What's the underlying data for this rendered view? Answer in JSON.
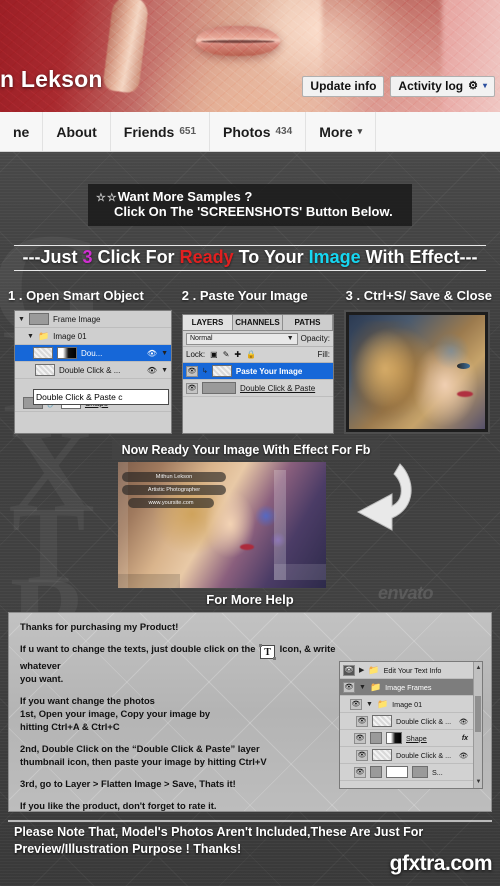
{
  "cover": {
    "profile_name": "n Lekson",
    "buttons": [
      {
        "label": "Update info",
        "icon": ""
      },
      {
        "label": "Activity log",
        "icon": "gear-icon",
        "caret": "▾"
      }
    ]
  },
  "nav": {
    "items": [
      {
        "label": "ne",
        "count": ""
      },
      {
        "label": "About",
        "count": ""
      },
      {
        "label": "Friends",
        "count": "651"
      },
      {
        "label": "Photos",
        "count": "434"
      },
      {
        "label": "More",
        "count": "",
        "caret": "▾"
      }
    ]
  },
  "samples": {
    "stars": "☆☆",
    "line1": "Want More Samples ?",
    "line2": "Click On The 'SCREENSHOTS' Button Below."
  },
  "headline": {
    "p1": "---Just ",
    "num": "3",
    "p2": " Click For ",
    "red": "Ready",
    "p3": " To Your ",
    "cyan": "Image",
    "p4": " With Effect---"
  },
  "steps": [
    "1 . Open Smart Object",
    "2 . Paste Your Image",
    "3 . Ctrl+S/ Save & Close"
  ],
  "panel_a": {
    "rows": [
      {
        "label": "Frame Image",
        "type": "group"
      },
      {
        "label": "Image 01",
        "type": "group"
      },
      {
        "label": "Dou...",
        "type": "layer-selected"
      },
      {
        "label": "Double Click & ...",
        "type": "layer"
      },
      {
        "label": "Shape",
        "type": "layer"
      }
    ],
    "callout": "Double Click & Paste c"
  },
  "panel_b": {
    "tabs": [
      "LAYERS",
      "CHANNELS",
      "PATHS"
    ],
    "blend_mode": "Normal",
    "opacity_label": "Opacity:",
    "lock_label": "Lock:",
    "fill_label": "Fill:",
    "rows": [
      {
        "label": "Paste Your Image",
        "type": "layer-selected"
      },
      {
        "label": "Double Click & Paste",
        "type": "layer"
      }
    ]
  },
  "result": {
    "title": "Now Ready Your Image With Effect For Fb",
    "overlay": [
      "Mithun Lekson",
      "Artistic Photographer",
      "www.yoursite.com"
    ]
  },
  "more_help": "For More Help",
  "envato_watermark": "envato",
  "help": {
    "p1": "Thanks for purchasing my Product!",
    "p2a": "If u want to change the texts, just double click on the",
    "t_icon": "T",
    "p2b": "Icon, & write whatever",
    "p2c": "you want.",
    "p3a": "If you want change the photos",
    "p3b": "1st, Open your image, Copy your image by",
    "p3c": "hitting Ctrl+A & Ctrl+C",
    "p4a": "2nd, Double Click on the “Double Click & Paste” layer",
    "p4b": "thumbnail icon, then paste your image by hitting Ctrl+V",
    "p5": "3rd, go to Layer > Flatten Image > Save, Thats it!",
    "p6": "If you like the product, don't forget to rate it."
  },
  "panel_d": {
    "rows": [
      {
        "label": "Edit Your Text Info",
        "type": "group"
      },
      {
        "label": "Image Frames",
        "type": "group-selected"
      },
      {
        "label": "Image 01",
        "type": "group"
      },
      {
        "label": "Double Click & ...",
        "type": "layer"
      },
      {
        "label": "Shape",
        "type": "layer",
        "fx": "fx"
      },
      {
        "label": "Double Click & ...",
        "type": "layer"
      },
      {
        "label": "S...",
        "type": "layer"
      }
    ]
  },
  "footer": {
    "line1": "Please Note That, Model's Photos Aren't Included,These Are Just For",
    "line2": "Preview/Illustration Purpose ! Thanks!",
    "watermark": "gfxtra.com"
  },
  "colors": {
    "accent_red": "#e02020",
    "accent_cyan": "#17d6f0",
    "accent_magenta": "#cf2fd0",
    "ps_selection_blue": "#1667d8"
  }
}
